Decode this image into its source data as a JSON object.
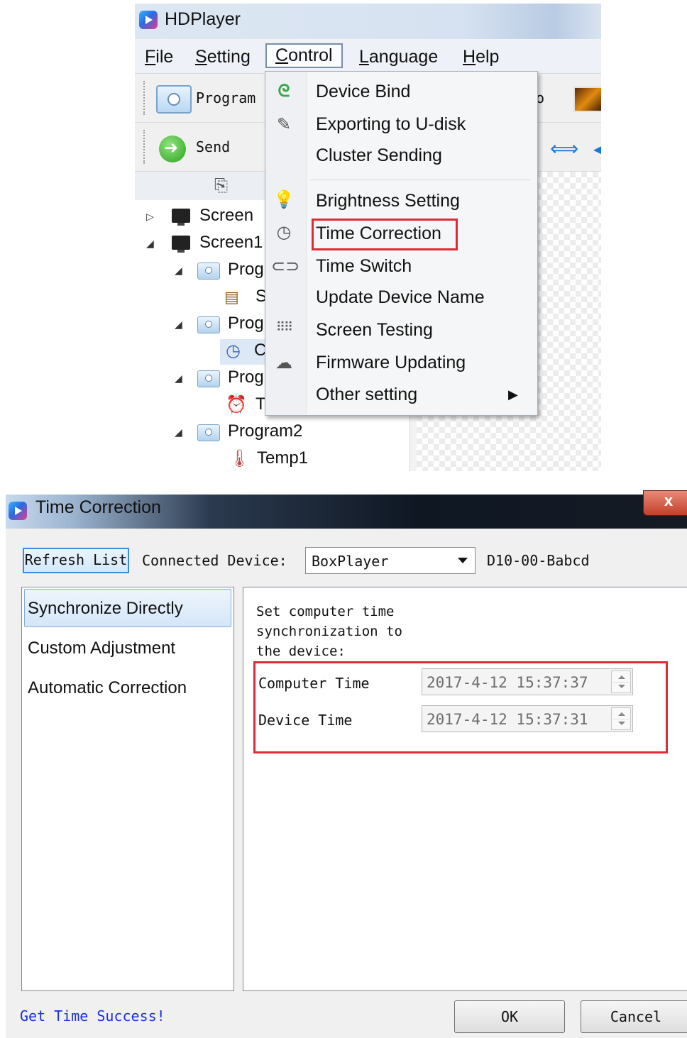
{
  "hdplayer": {
    "title": "HDPlayer",
    "menubar": {
      "file": "File",
      "setting": "Setting",
      "control": "Control",
      "language": "Language",
      "help": "Help"
    },
    "toolbar": {
      "program": "Program",
      "send": "Send",
      "partial_label": "o"
    },
    "tree": [
      {
        "label": "Screen",
        "level": 0,
        "expanded": false,
        "icon": "monitor-icon"
      },
      {
        "label": "Screen1",
        "level": 0,
        "expanded": true,
        "icon": "monitor-icon"
      },
      {
        "label": "Prog",
        "level": 1,
        "expanded": true,
        "icon": "program-icon"
      },
      {
        "label": "S",
        "level": 2,
        "icon": "subtitle-icon"
      },
      {
        "label": "Prog",
        "level": 1,
        "expanded": true,
        "icon": "program-icon"
      },
      {
        "label": "C",
        "level": 2,
        "icon": "clock-icon"
      },
      {
        "label": "Prog",
        "level": 1,
        "expanded": true,
        "icon": "program-icon"
      },
      {
        "label": "T",
        "level": 2,
        "icon": "alarm-clock-icon"
      },
      {
        "label": "Program2",
        "level": 1,
        "expanded": true,
        "icon": "program-icon"
      },
      {
        "label": "Temp1",
        "level": 2,
        "icon": "thermometer-icon"
      }
    ],
    "control_menu": {
      "items": [
        {
          "label": "Device Bind",
          "icon": "magnet-icon"
        },
        {
          "label": "Exporting to U-disk",
          "icon": "usb-icon"
        },
        {
          "label": "Cluster Sending",
          "icon": ""
        },
        {
          "label": "Brightness Setting",
          "icon": "bulb-icon"
        },
        {
          "label": "Time Correction",
          "icon": "clock-icon",
          "highlighted": true
        },
        {
          "label": "Time Switch",
          "icon": "toggle-icon"
        },
        {
          "label": "Update Device Name",
          "icon": ""
        },
        {
          "label": "Screen Testing",
          "icon": "grid-dots-icon"
        },
        {
          "label": "Firmware Updating",
          "icon": "cloud-refresh-icon"
        },
        {
          "label": "Other setting",
          "icon": "",
          "has_submenu": true
        }
      ]
    }
  },
  "dialog": {
    "title": "Time Correction",
    "close_glyph": "x",
    "refresh_button": "Refresh List",
    "connected_device_label": "Connected Device:",
    "device_select_value": "BoxPlayer",
    "device_id": "D10-00-Babcd",
    "sidebar": [
      {
        "label": "Synchronize Directly",
        "selected": true
      },
      {
        "label": "Custom Adjustment",
        "selected": false
      },
      {
        "label": "Automatic Correction",
        "selected": false
      }
    ],
    "description_lines": [
      "Set computer time",
      "synchronization to",
      "the device:"
    ],
    "computer_time_label": "Computer Time",
    "computer_time_value": "2017-4-12 15:37:37",
    "device_time_label": "Device Time",
    "device_time_value": "2017-4-12 15:37:31",
    "status": "Get Time Success!",
    "ok_button": "OK",
    "cancel_button": "Cancel"
  },
  "colors": {
    "highlight_red": "#e02a36",
    "status_blue": "#1b2fe0",
    "selection_blue": "#84acdd"
  }
}
